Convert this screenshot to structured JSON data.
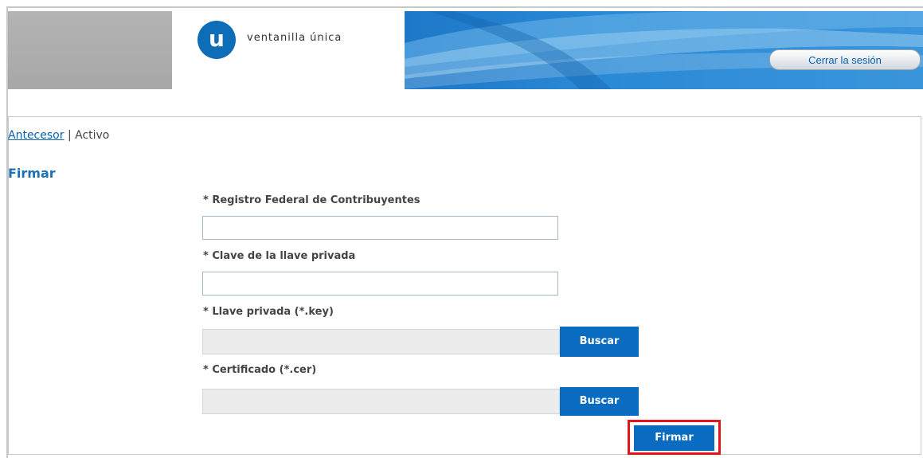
{
  "header": {
    "logo_letter": "u",
    "logo_text": "ventanilla única",
    "logout_label": "Cerrar la sesión"
  },
  "breadcrumb": {
    "link_label": "Antecesor",
    "separator": "|",
    "current_label": "Activo"
  },
  "form": {
    "title": "Firmar",
    "rfc_label": "* Registro Federal de Contribuyentes",
    "rfc_value": "",
    "password_label": "* Clave de la llave privada",
    "password_value": "",
    "key_label": "* Llave privada (*.key)",
    "key_value": "",
    "key_button": "Buscar",
    "cert_label": "* Certificado (*.cer)",
    "cert_value": "",
    "cert_button": "Buscar",
    "submit_label": "Firmar"
  },
  "colors": {
    "brand_blue": "#0a6cc0",
    "highlight_red": "#e3141b"
  }
}
